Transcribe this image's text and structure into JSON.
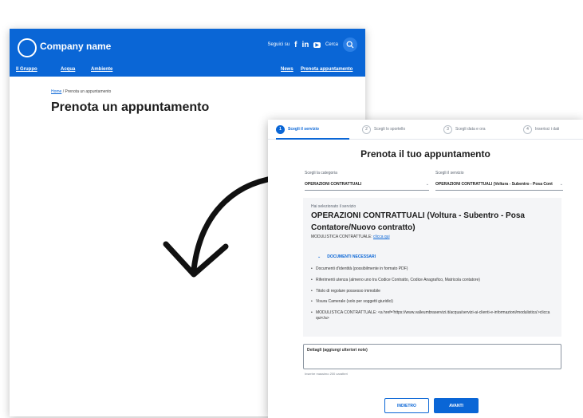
{
  "back_page": {
    "company_name": "Company name",
    "follow_label": "Seguici su",
    "social_icons": [
      "facebook-icon",
      "linkedin-icon",
      "youtube-icon"
    ],
    "social_glyphs": {
      "facebook": "f",
      "linkedin": "in",
      "youtube": "▶"
    },
    "search_label": "Cerca",
    "nav_left": [
      "Il Gruppo",
      "Acqua",
      "Ambiente"
    ],
    "nav_right": [
      "News",
      "Prenota appuntamento"
    ],
    "breadcrumb": {
      "home": "Home",
      "separator": "/",
      "current": "Prenota un appuntamento"
    },
    "title": "Prenota un appuntamento"
  },
  "booking": {
    "steps": [
      {
        "num": "1",
        "label": "Scegli il servizio",
        "active": true
      },
      {
        "num": "2",
        "label": "Scegli lo sportello",
        "active": false
      },
      {
        "num": "3",
        "label": "Scegli data e ora",
        "active": false
      },
      {
        "num": "4",
        "label": "Inserisci i dati",
        "active": false
      }
    ],
    "title": "Prenota il tuo appuntamento",
    "category_label": "Scegli la categoria",
    "category_value": "OPERAZIONI CONTRATTUALI",
    "service_label": "Scegli il servizio",
    "service_value": "OPERAZIONI CONTRATTUALI (Voltura - Subentro - Posa Cont",
    "selected_label": "Hai selezionato il servizio",
    "selected_title": "OPERAZIONI CONTRATTUALI (Voltura - Subentro - Posa Contatore/Nuovo contratto)",
    "modulistica_label": "MODULISTICA CONTRATTUALE:",
    "modulistica_link": "clicca qui",
    "docs_toggle": "DOCUMENTI NECESSARI",
    "docs": [
      "Documenti d'identità (possibilmente in formato PDF)",
      "Riferimenti utenza (almeno uno tra Codice Contratto, Codice Anagrafico, Matricola contatore)",
      "Titolo di regolare possesso immobile",
      "Visura Camerale (solo per soggetti giuridici)",
      "MODULISTICA CONTRATTUALE: <a href='https://www.valleumbraservizi.it/acqua/servizi-ai-clienti-e-informazioni/modulistica'>clicca qui</a>"
    ],
    "notes_label": "Dettagli (aggiungi ulteriori note)",
    "notes_hint": "Inserire massimo 200 caratteri",
    "back_button": "INDIETRO",
    "next_button": "AVANTI"
  },
  "colors": {
    "brand": "#0a66d6"
  }
}
